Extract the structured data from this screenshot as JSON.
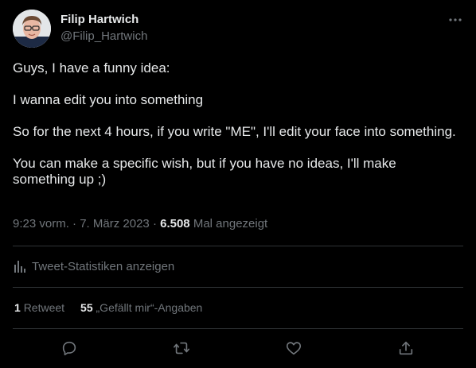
{
  "author": {
    "name": "Filip Hartwich",
    "handle": "@Filip_Hartwich"
  },
  "tweet": {
    "paragraphs": [
      "Guys, I have a funny idea:",
      "I wanna edit you into something",
      "So for the next 4 hours, if you write \"ME\", I'll edit your face into something.",
      "You can make a specific wish, but if you have no ideas, I'll make something up ;)"
    ]
  },
  "meta": {
    "time": "9:23 vorm.",
    "separator": "·",
    "date": "7. März 2023",
    "views_count": "6.508",
    "views_label": "Mal angezeigt"
  },
  "stats": {
    "link_label": "Tweet-Statistiken anzeigen"
  },
  "engagement": {
    "retweets_count": "1",
    "retweets_label": "Retweet",
    "likes_count": "55",
    "likes_label": "„Gefällt mir“-Angaben"
  },
  "icons": {
    "more": "more-dots-icon",
    "stats": "bar-chart-icon",
    "reply": "reply-icon",
    "retweet": "retweet-icon",
    "like": "heart-icon",
    "share": "share-icon"
  },
  "colors": {
    "background": "#000000",
    "text": "#e7e9ea",
    "muted": "#71767b",
    "divider": "#2f3336"
  }
}
